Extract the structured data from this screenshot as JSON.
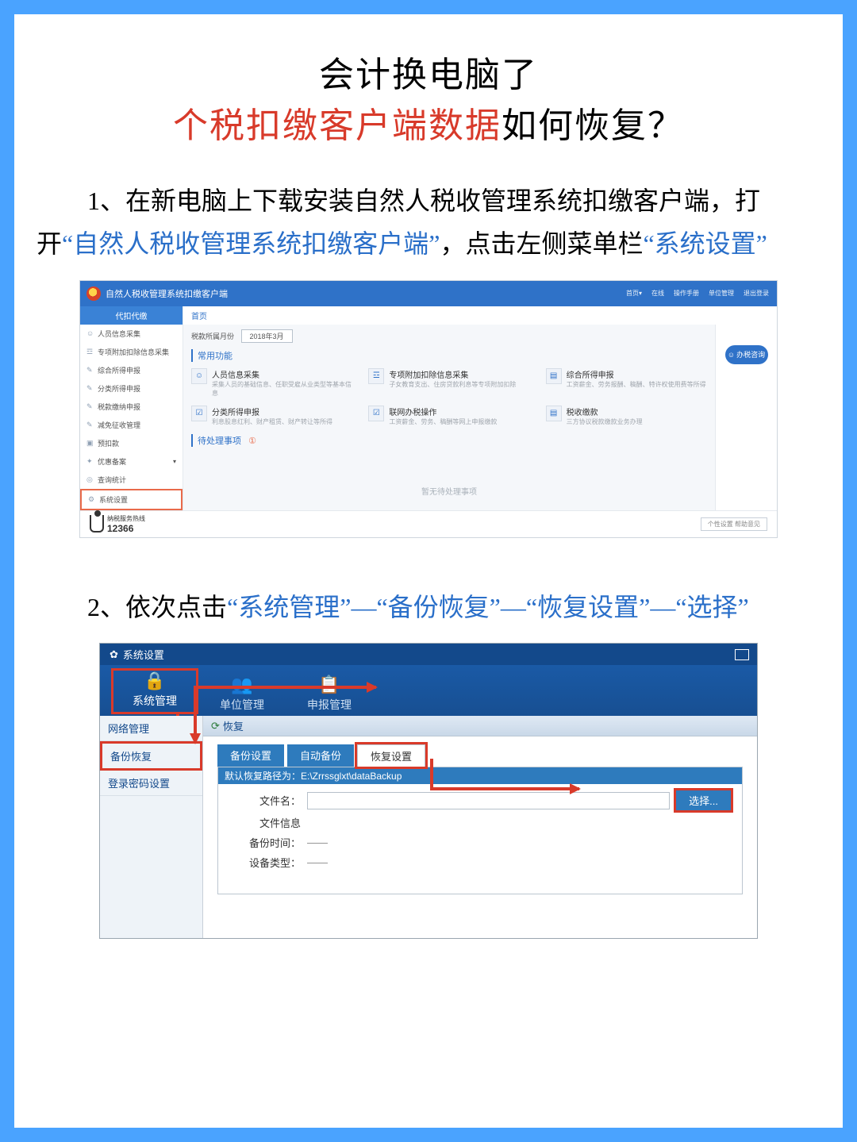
{
  "title": {
    "line1": "会计换电脑了",
    "line2_a": "个税扣缴客户端数据",
    "line2_b": "如何恢复？"
  },
  "step1": {
    "n": "1、",
    "p1": "在新电脑上下载安装自然人税收管理系统扣缴客户端，打开",
    "q1": "“自然人税收管理系统扣缴客户端”",
    "p2": "，点击左侧菜单栏",
    "q2": "“系统设置”"
  },
  "app1": {
    "header_title": "自然人税收管理系统扣缴客户端",
    "header_nav": [
      "首页▾",
      "在线",
      "操作手册",
      "单位管理",
      "退出登录"
    ],
    "left_top": "代扣代缴",
    "left_tab": "首页",
    "tax_label": "税款所属月份",
    "tax_value": "2018年3月",
    "section1": "常用功能",
    "cards1": [
      {
        "h": "人员信息采集",
        "s": "采集人员的基础信息、任职受雇从业类型等基本信息"
      },
      {
        "h": "专项附加扣除信息采集",
        "s": "子女教育支出、住房贷款利息等专项附加扣除"
      },
      {
        "h": "综合所得申报",
        "s": "工资薪金、劳务报酬、稿酬、特许权使用费等所得"
      }
    ],
    "cards2": [
      {
        "h": "分类所得申报",
        "s": "利息股息红利、财产租赁、财产转让等所得"
      },
      {
        "h": "联网办税操作",
        "s": "工资薪金、劳务、稿酬等网上申报缴款"
      },
      {
        "h": "税收缴款",
        "s": "三方协议税款缴款业务办理"
      }
    ],
    "consult": "办税咨询",
    "sidebar": [
      "人员信息采集",
      "专项附加扣除信息采集",
      "综合所得申报",
      "分类所得申报",
      "税款缴纳申报",
      "减免征收管理",
      "预扣款",
      "优惠备案",
      "查询统计",
      "系统设置"
    ],
    "section2": "待处理事项",
    "pending_badge": "①",
    "empty": "暂无待处理事项",
    "hotline": "12366",
    "hotline_label": "纳税服务热线",
    "footer_btn": "个性设置  帮助意见"
  },
  "step2": {
    "n": "2、",
    "p1": "依次点击",
    "q1": "“系统管理”",
    "d": "—",
    "q2": "“备份恢复”",
    "q3": "“恢复设置”",
    "q4": "“选择”"
  },
  "app2": {
    "title": "系统设置",
    "tabs": [
      "系统管理",
      "单位管理",
      "申报管理"
    ],
    "left_items": [
      "网络管理",
      "备份恢复",
      "登录密码设置"
    ],
    "restore_head": "恢复",
    "subtabs": [
      "备份设置",
      "自动备份",
      "恢复设置"
    ],
    "path_label": "默认恢复路径为：E:\\Zrrssglxt\\dataBackup",
    "file_name_label": "文件名：",
    "select_btn": "选择...",
    "file_info_label": "文件信息",
    "backup_time_label": "备份时间：",
    "device_type_label": "设备类型：",
    "dash": "——"
  }
}
